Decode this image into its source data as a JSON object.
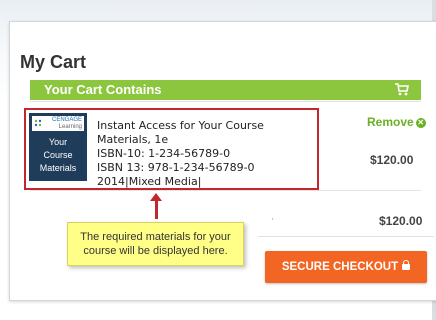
{
  "page": {
    "title": "My Cart"
  },
  "cart_bar": {
    "label": "Your Cart Contains",
    "icon": "cart-icon"
  },
  "product": {
    "thumbnail": {
      "brand_line1": "CENGAGE",
      "brand_line2": "Learning",
      "text_line1": "Your",
      "text_line2": "Course",
      "text_line3": "Materials"
    },
    "name": "Instant Access for Your Course Materials, 1e",
    "isbn10": "ISBN-10: 1-234-56789-0",
    "isbn13": "ISBN 13: 978-1-234-56789-0",
    "edition": "2014|Mixed Media|",
    "remove_label": "Remove",
    "price": "$120.00"
  },
  "summary": {
    "marker": "'",
    "total": "$120.00"
  },
  "checkout": {
    "label": "SECURE CHECKOUT"
  },
  "callout": {
    "line1": "The required materials for your",
    "line2": "course will be displayed here."
  },
  "colors": {
    "accent_green": "#8cc63f",
    "checkout_orange": "#f26522",
    "highlight_red": "#c1272d",
    "callout_yellow": "#ffff88"
  }
}
